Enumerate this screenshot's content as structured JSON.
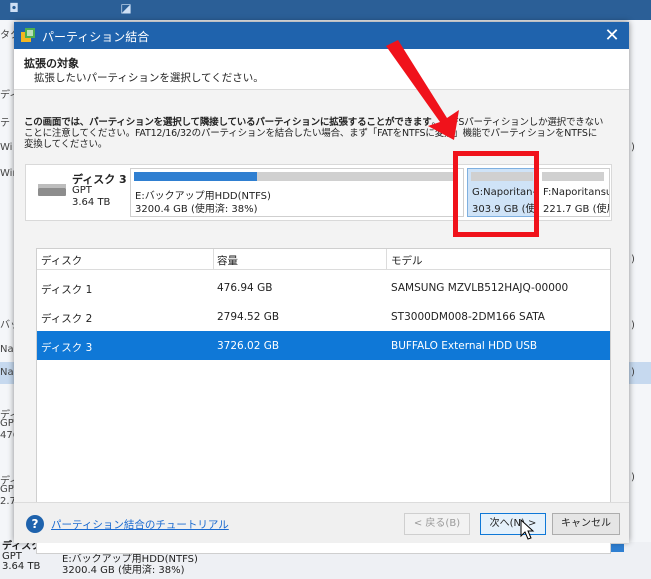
{
  "background": {
    "left_labels": [
      "タク",
      "ディ",
      "テ",
      "Wi",
      "Win",
      "バッ",
      "Nap",
      "Nap",
      "ディ",
      "GPT",
      "476",
      "ディ",
      "GPT",
      "2.7"
    ],
    "right_labels": [
      ")",
      ")",
      ")",
      ")",
      ")"
    ],
    "bottom": {
      "disk_name": "ディスク 3",
      "disk_type": "GPT",
      "disk_size": "3.64 TB",
      "partition_name": "E:バックアップ用HDD(NTFS)",
      "partition_info": "3200.4 GB (使用済: 38%)"
    }
  },
  "dialog": {
    "title": "パーティション結合",
    "close_label": "✕",
    "header": {
      "title": "拡張の対象",
      "subtitle": "拡張したいパーティションを選択してください。"
    },
    "notice": {
      "bold": "この画面では、パーティションを選択して隣接しているパーティションに拡張することができます",
      "rest": "。NTFSパーティションしか選択できないことに注意してください。FAT12/16/32のパーティションを結合したい場合、まず「FATをNTFSに変換」機能でパーティションをNTFSに変換してください。"
    },
    "disk_map": {
      "name": "ディスク 3",
      "type": "GPT",
      "size": "3.64 TB",
      "partitions": [
        {
          "name": "E:バックアップ用HDD(NTFS)",
          "info": "3200.4 GB (使用済: 38%)",
          "used": 0.38
        },
        {
          "name": "G:Naporitan-",
          "info": "303.9 GB (使用",
          "used": 0
        },
        {
          "name": "F:Naporitansu",
          "info": "221.7 GB (使用",
          "used": 0
        }
      ]
    },
    "table": {
      "headers": [
        "ディスク",
        "容量",
        "モデル"
      ],
      "rows": [
        {
          "disk": "ディスク 1",
          "capacity": "476.94 GB",
          "model": "SAMSUNG MZVLB512HAJQ-00000"
        },
        {
          "disk": "ディスク 2",
          "capacity": "2794.52 GB",
          "model": "ST3000DM008-2DM166 SATA"
        },
        {
          "disk": "ディスク 3",
          "capacity": "3726.02 GB",
          "model": "BUFFALO External HDD USB"
        }
      ],
      "selected_index": 2
    },
    "footer": {
      "help_icon": "?",
      "tutorial_link": "パーティション結合のチュートリアル",
      "back_label": "< 戻る(B)",
      "next_label": "次へ(N) >",
      "cancel_label": "キャンセル"
    }
  },
  "colors": {
    "titlebar": "#1f63ad",
    "selection": "#0f78d7",
    "annotation": "#f0121b",
    "disk_bar": "#2f7fd1"
  }
}
